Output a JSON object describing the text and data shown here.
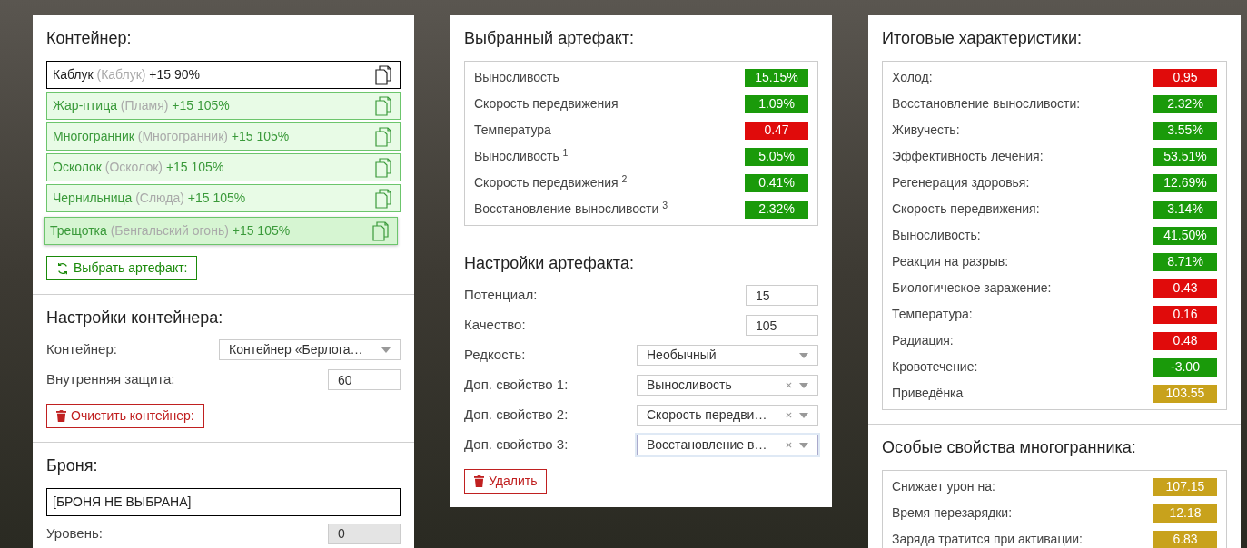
{
  "container": {
    "title": "Контейнер:",
    "slots": [
      {
        "name": "Каблук",
        "type": "(Каблук)",
        "stats": "+15 90%",
        "selected": true,
        "dragging": false
      },
      {
        "name": "Жар-птица",
        "type": "(Пламя)",
        "stats": "+15 105%",
        "selected": false,
        "dragging": false
      },
      {
        "name": "Многогранник",
        "type": "(Многогранник)",
        "stats": "+15 105%",
        "selected": false,
        "dragging": false
      },
      {
        "name": "Осколок",
        "type": "(Осколок)",
        "stats": "+15 105%",
        "selected": false,
        "dragging": false
      },
      {
        "name": "Чернильница",
        "type": "(Слюда)",
        "stats": "+15 105%",
        "selected": false,
        "dragging": false
      },
      {
        "name": "Трещотка",
        "type": "(Бенгальский огонь)",
        "stats": "+15 105%",
        "selected": false,
        "dragging": true
      }
    ],
    "pick_button": "Выбрать артефакт:"
  },
  "container_settings": {
    "title": "Настройки контейнера:",
    "fields": [
      {
        "kind": "select",
        "label": "Контейнер:",
        "value": "Контейнер «Берлога…"
      },
      {
        "kind": "number",
        "label": "Внутренняя защита:",
        "value": "60"
      }
    ],
    "clear_button": "Очистить контейнер:"
  },
  "armor": {
    "title": "Броня:",
    "selection": "[БРОНЯ НЕ ВЫБРАНА]",
    "fields": [
      {
        "kind": "number",
        "label": "Уровень:",
        "value": "0",
        "disabled": true
      }
    ]
  },
  "selected_artifact": {
    "title": "Выбранный артефакт:",
    "stats": [
      {
        "label": "Выносливость",
        "value": "15.15%",
        "color": "#1a9a0a"
      },
      {
        "label": "Скорость передвижения",
        "value": "1.09%",
        "color": "#1a9a0a"
      },
      {
        "label": "Температура",
        "value": "0.47",
        "color": "#e00b0b"
      },
      {
        "label": "Выносливость $^{1}$",
        "value": "5.05%",
        "color": "#1a9a0a"
      },
      {
        "label": "Скорость передвижения $^{2}$",
        "value": "0.41%",
        "color": "#1a9a0a"
      },
      {
        "label": "Восстановление выносливости $^{3}$",
        "value": "2.32%",
        "color": "#1a9a0a"
      }
    ]
  },
  "artifact_settings": {
    "title": "Настройки артефакта:",
    "fields": [
      {
        "kind": "number",
        "label": "Потенциал:",
        "value": "15"
      },
      {
        "kind": "number",
        "label": "Качество:",
        "value": "105"
      },
      {
        "kind": "select",
        "label": "Редкость:",
        "value": "Необычный",
        "clearable": false,
        "focused": false
      },
      {
        "kind": "select",
        "label": "Доп. свойство 1:",
        "value": "Выносливость",
        "clearable": true,
        "focused": false
      },
      {
        "kind": "select",
        "label": "Доп. свойство 2:",
        "value": "Скорость передви…",
        "clearable": true,
        "focused": false
      },
      {
        "kind": "select",
        "label": "Доп. свойство 3:",
        "value": "Восстановление в…",
        "clearable": true,
        "focused": true
      }
    ],
    "delete_button": "Удалить"
  },
  "total_stats": {
    "title": "Итоговые характеристики:",
    "stats": [
      {
        "label": "Холод:",
        "value": "0.95",
        "color": "#e00b0b"
      },
      {
        "label": "Восстановление выносливости:",
        "value": "2.32%",
        "color": "#1a9a0a"
      },
      {
        "label": "Живучесть:",
        "value": "3.55%",
        "color": "#1a9a0a"
      },
      {
        "label": "Эффективность лечения:",
        "value": "53.51%",
        "color": "#1a9a0a"
      },
      {
        "label": "Регенерация здоровья:",
        "value": "12.69%",
        "color": "#1a9a0a"
      },
      {
        "label": "Скорость передвижения:",
        "value": "3.14%",
        "color": "#1a9a0a"
      },
      {
        "label": "Выносливость:",
        "value": "41.50%",
        "color": "#1a9a0a"
      },
      {
        "label": "Реакция на разрыв:",
        "value": "8.71%",
        "color": "#1a9a0a"
      },
      {
        "label": "Биологическое заражение:",
        "value": "0.43",
        "color": "#e00b0b"
      },
      {
        "label": "Температура:",
        "value": "0.16",
        "color": "#e00b0b"
      },
      {
        "label": "Радиация:",
        "value": "0.48",
        "color": "#e00b0b"
      },
      {
        "label": "Кровотечение:",
        "value": "-3.00",
        "color": "#1a9a0a"
      },
      {
        "label": "Приведёнка",
        "value": "103.55",
        "color": "#c8a21c"
      }
    ]
  },
  "special_props": {
    "title": "Особые свойства многогранника:",
    "stats": [
      {
        "label": "Снижает урон на:",
        "value": "107.15",
        "color": "#c8a21c"
      },
      {
        "label": "Время перезарядки:",
        "value": "12.18",
        "color": "#c8a21c"
      },
      {
        "label": "Заряда тратится при активации:",
        "value": "6.83",
        "color": "#c8a21c"
      }
    ]
  }
}
